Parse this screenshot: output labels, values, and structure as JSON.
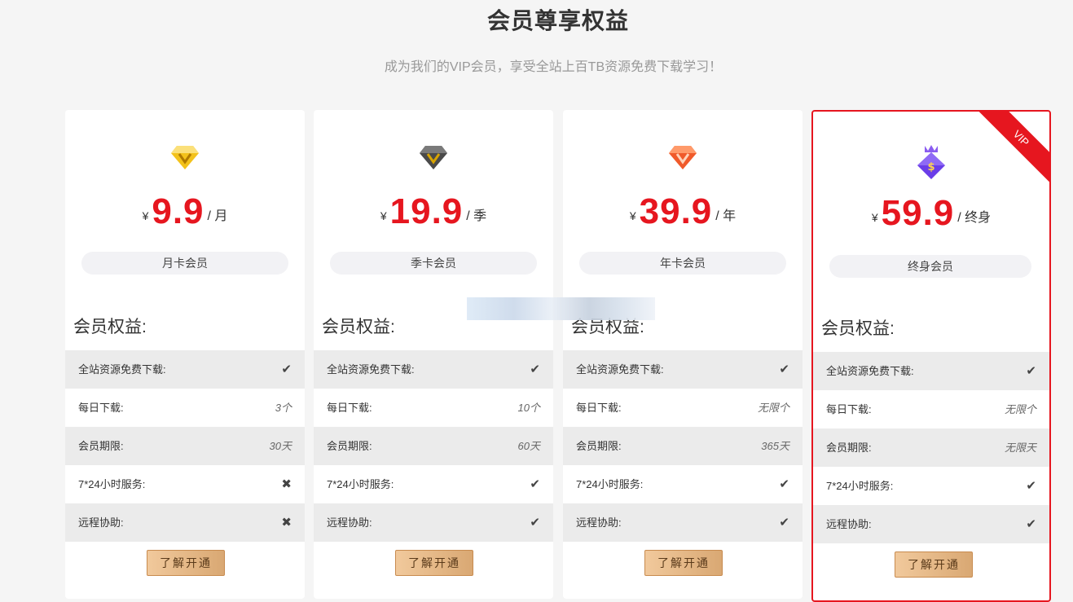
{
  "header": {
    "title": "会员尊享权益",
    "subtitle": "成为我们的VIP会员，享受全站上百TB资源免费下载学习！"
  },
  "benefit_labels": {
    "download": "全站资源免费下载:",
    "daily": "每日下载:",
    "period": "会员期限:",
    "service": "7*24小时服务:",
    "remote": "远程协助:"
  },
  "plans": [
    {
      "icon": "gold-diamond-icon",
      "currency": "¥",
      "price": "9.9",
      "unit": "/ 月",
      "tier": "月卡会员",
      "benefits_title": "会员权益:",
      "download": "check",
      "daily": "3个",
      "period": "30天",
      "service": "cross",
      "remote": "cross",
      "cta": "了解开通"
    },
    {
      "icon": "dark-diamond-icon",
      "currency": "¥",
      "price": "19.9",
      "unit": "/ 季",
      "tier": "季卡会员",
      "benefits_title": "会员权益:",
      "download": "check",
      "daily": "10个",
      "period": "60天",
      "service": "check",
      "remote": "check",
      "cta": "了解开通"
    },
    {
      "icon": "orange-diamond-icon",
      "currency": "¥",
      "price": "39.9",
      "unit": "/ 年",
      "tier": "年卡会员",
      "benefits_title": "会员权益:",
      "download": "check",
      "daily": "无限个",
      "period": "365天",
      "service": "check",
      "remote": "check",
      "cta": "了解开通"
    },
    {
      "icon": "purple-crown-diamond-icon",
      "currency": "¥",
      "price": "59.9",
      "unit": "/ 终身",
      "tier": "终身会员",
      "benefits_title": "会员权益:",
      "download": "check",
      "daily": "无限个",
      "period": "无限天",
      "service": "check",
      "remote": "check",
      "cta": "了解开通",
      "ribbon": "VIP"
    }
  ],
  "colors": {
    "price": "#e6161f",
    "featured_border": "#e6161f",
    "cta_gradient_start": "#f1c99c",
    "cta_gradient_end": "#d9a873"
  }
}
